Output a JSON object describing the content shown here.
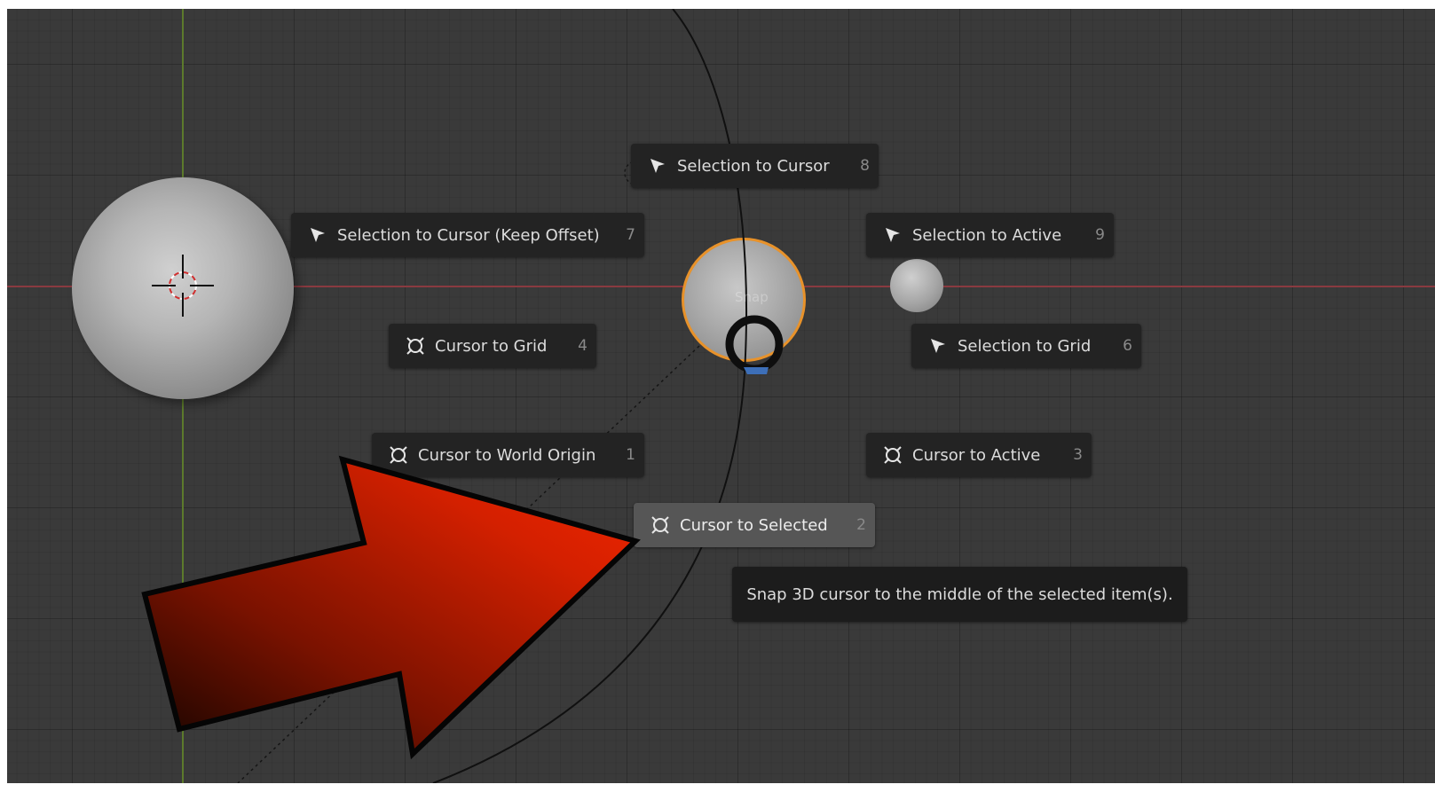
{
  "pie_menu": {
    "center_label": "Snap",
    "items": [
      {
        "label": "Selection to Cursor",
        "key": "8",
        "icon": "pointer-arrow-icon"
      },
      {
        "label": "Selection to Cursor (Keep Offset)",
        "key": "7",
        "icon": "pointer-arrow-icon"
      },
      {
        "label": "Selection to Active",
        "key": "9",
        "icon": "pointer-arrow-icon"
      },
      {
        "label": "Cursor to Grid",
        "key": "4",
        "icon": "cursor-crosshair-icon"
      },
      {
        "label": "Selection to Grid",
        "key": "6",
        "icon": "pointer-arrow-icon"
      },
      {
        "label": "Cursor to World Origin",
        "key": "1",
        "icon": "cursor-crosshair-icon"
      },
      {
        "label": "Cursor to Active",
        "key": "3",
        "icon": "cursor-crosshair-icon"
      },
      {
        "label": "Cursor to Selected",
        "key": "2",
        "icon": "cursor-crosshair-icon",
        "highlighted": true
      }
    ]
  },
  "tooltip": {
    "text": "Snap 3D cursor to the middle of the selected item(s)."
  },
  "colors": {
    "viewport_bg": "#3a3a3a",
    "x_axis": "#8a3a40",
    "y_axis": "#5c7a2c",
    "selection_outline": "#e8922a",
    "annotation_arrow": "#e82200"
  }
}
